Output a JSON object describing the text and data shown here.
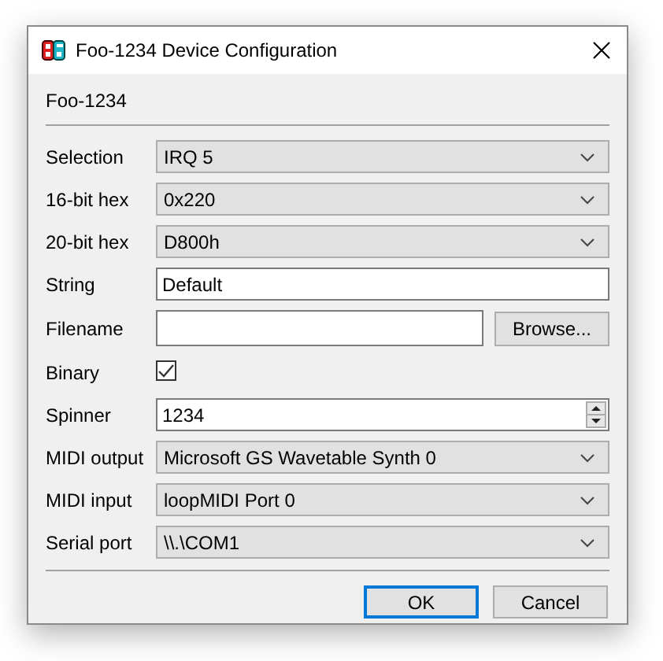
{
  "window": {
    "title": "Foo-1234 Device Configuration"
  },
  "device_name": "Foo-1234",
  "fields": [
    {
      "kind": "dropdown",
      "label": "Selection",
      "value": "IRQ 5"
    },
    {
      "kind": "dropdown",
      "label": "16-bit hex",
      "value": "0x220"
    },
    {
      "kind": "dropdown",
      "label": "20-bit hex",
      "value": "D800h"
    },
    {
      "kind": "text",
      "label": "String",
      "value": "Default"
    },
    {
      "kind": "file",
      "label": "Filename",
      "button": "Browse..."
    },
    {
      "kind": "checkbox",
      "label": "Binary",
      "checked": true
    },
    {
      "kind": "spinner",
      "label": "Spinner",
      "value": "1234"
    },
    {
      "kind": "dropdown",
      "label": "MIDI output",
      "value": "Microsoft GS Wavetable Synth 0"
    },
    {
      "kind": "dropdown",
      "label": "MIDI input",
      "value": "loopMIDI Port 0"
    },
    {
      "kind": "dropdown",
      "label": "Serial port",
      "value": "\\\\.\\COM1"
    }
  ],
  "buttons": [
    {
      "label": "OK",
      "default": true
    },
    {
      "label": "Cancel",
      "default": false
    }
  ]
}
